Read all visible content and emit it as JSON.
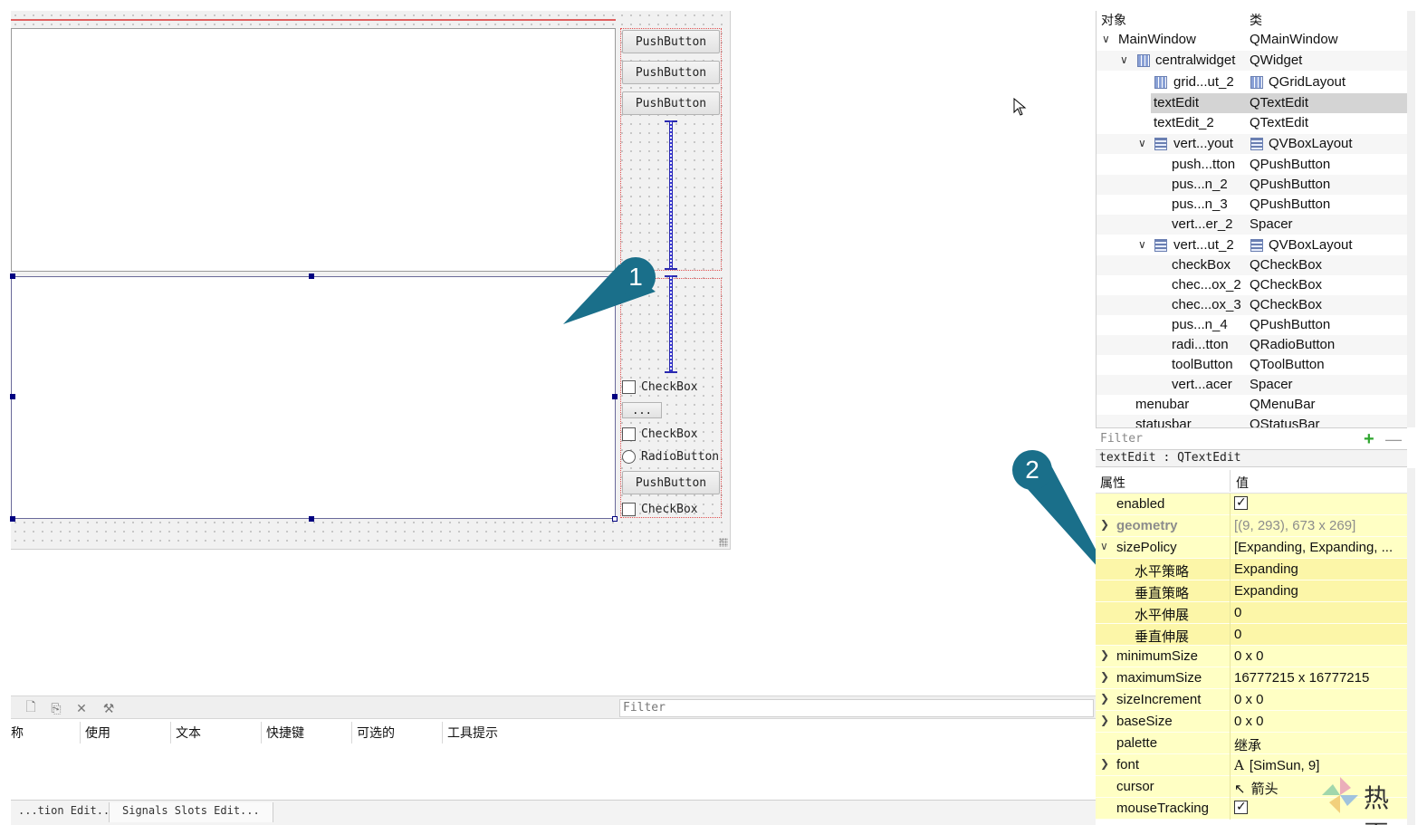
{
  "form": {
    "buttons": [
      "PushButton",
      "PushButton",
      "PushButton",
      "PushButton"
    ],
    "checkboxes": [
      "CheckBox",
      "CheckBox",
      "CheckBox"
    ],
    "radio": "RadioButton",
    "tool_button": "..."
  },
  "callouts": [
    "1",
    "2"
  ],
  "object_inspector": {
    "col_object": "对象",
    "col_class": "类",
    "rows": [
      {
        "name": "MainWindow",
        "cls": "QMainWindow"
      },
      {
        "name": "centralwidget",
        "cls": "QWidget"
      },
      {
        "name": "grid...ut_2",
        "cls": "QGridLayout"
      },
      {
        "name": "textEdit",
        "cls": "QTextEdit"
      },
      {
        "name": "textEdit_2",
        "cls": "QTextEdit"
      },
      {
        "name": "vert...yout",
        "cls": "QVBoxLayout"
      },
      {
        "name": "push...tton",
        "cls": "QPushButton"
      },
      {
        "name": "pus...n_2",
        "cls": "QPushButton"
      },
      {
        "name": "pus...n_3",
        "cls": "QPushButton"
      },
      {
        "name": "vert...er_2",
        "cls": "Spacer"
      },
      {
        "name": "vert...ut_2",
        "cls": "QVBoxLayout"
      },
      {
        "name": "checkBox",
        "cls": "QCheckBox"
      },
      {
        "name": "chec...ox_2",
        "cls": "QCheckBox"
      },
      {
        "name": "chec...ox_3",
        "cls": "QCheckBox"
      },
      {
        "name": "pus...n_4",
        "cls": "QPushButton"
      },
      {
        "name": "radi...tton",
        "cls": "QRadioButton"
      },
      {
        "name": "toolButton",
        "cls": "QToolButton"
      },
      {
        "name": "vert...acer",
        "cls": "Spacer"
      },
      {
        "name": "menubar",
        "cls": "QMenuBar"
      },
      {
        "name": "statusbar",
        "cls": "QStatusBar"
      }
    ],
    "filter_placeholder": "Filter"
  },
  "property_editor": {
    "object_label": "textEdit : QTextEdit",
    "col_property": "属性",
    "col_value": "值",
    "rows": [
      {
        "name": "enabled",
        "value": "",
        "checked": true
      },
      {
        "name": "geometry",
        "value": "[(9, 293), 673 x 269]"
      },
      {
        "name": "sizePolicy",
        "value": "[Expanding, Expanding, ..."
      },
      {
        "name": "水平策略",
        "value": "Expanding"
      },
      {
        "name": "垂直策略",
        "value": "Expanding"
      },
      {
        "name": "水平伸展",
        "value": "0"
      },
      {
        "name": "垂直伸展",
        "value": "0"
      },
      {
        "name": "minimumSize",
        "value": "0 x 0"
      },
      {
        "name": "maximumSize",
        "value": "16777215 x 16777215"
      },
      {
        "name": "sizeIncrement",
        "value": "0 x 0"
      },
      {
        "name": "baseSize",
        "value": "0 x 0"
      },
      {
        "name": "palette",
        "value": "继承"
      },
      {
        "name": "font",
        "value": "[SimSun, 9]"
      },
      {
        "name": "cursor",
        "value": "箭头"
      },
      {
        "name": "mouseTracking",
        "value": "",
        "checked": true
      }
    ]
  },
  "action_editor": {
    "filter_placeholder": "Filter",
    "columns": [
      "称",
      "使用",
      "文本",
      "快捷键",
      "可选的",
      "工具提示"
    ],
    "tabs": [
      "...tion Edit...",
      "Signals Slots Edit..."
    ]
  },
  "watermark": "热夏",
  "colors": {
    "callout": "#1a6f8a",
    "property_bg": "#ffffc4",
    "selection": "#d4d4d4"
  }
}
